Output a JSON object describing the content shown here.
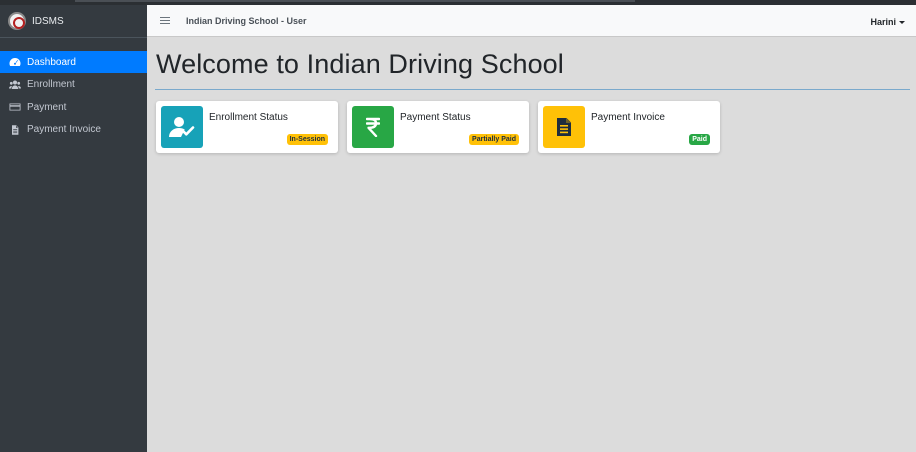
{
  "brand": {
    "name": "IDSMS"
  },
  "sidebar": {
    "items": [
      {
        "label": "Dashboard",
        "icon": "dashboard-icon",
        "active": true
      },
      {
        "label": "Enrollment",
        "icon": "users-icon",
        "active": false
      },
      {
        "label": "Payment",
        "icon": "credit-card-icon",
        "active": false
      },
      {
        "label": "Payment Invoice",
        "icon": "file-icon",
        "active": false
      }
    ]
  },
  "header": {
    "title": "Indian Driving School - User",
    "user": "Harini"
  },
  "main": {
    "welcome": "Welcome to Indian Driving School",
    "cards": [
      {
        "title": "Enrollment Status",
        "badge": "In-Session",
        "icon": "user-check-icon",
        "icon_color": "#17a2b8",
        "badge_color": "#ffc107",
        "badge_text_color": "#1f2d3d"
      },
      {
        "title": "Payment Status",
        "badge": "Partially Paid",
        "icon": "rupee-icon",
        "icon_color": "#28a745",
        "badge_color": "#ffc107",
        "badge_text_color": "#1f2d3d"
      },
      {
        "title": "Payment Invoice",
        "badge": "Paid",
        "icon": "invoice-icon",
        "icon_color": "#ffc107",
        "badge_color": "#28a745",
        "badge_text_color": "#ffffff"
      }
    ]
  },
  "colors": {
    "sidebar_bg": "#343a40",
    "active": "#007bff",
    "content_bg": "#dcdcdc"
  }
}
